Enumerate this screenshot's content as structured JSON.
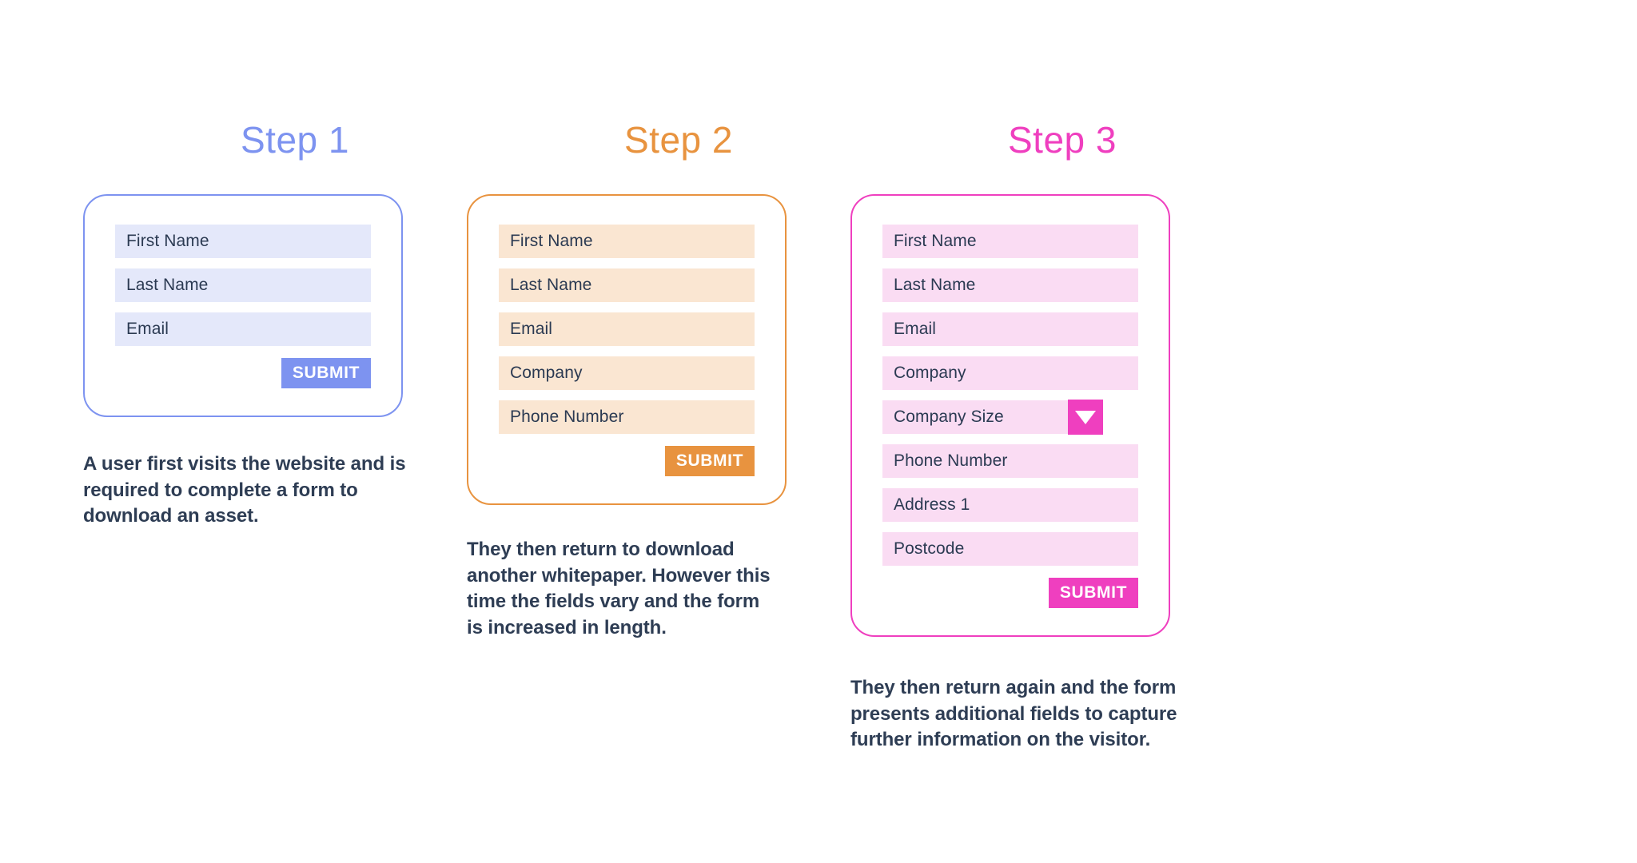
{
  "page": {
    "background": "#ffffff",
    "text_color": "#2e3d54"
  },
  "steps": [
    {
      "title": "Step 1",
      "accent": "#7d93f0",
      "field_fill": "#e4e8fa",
      "border": "#7d93f0",
      "submit_label": "SUBMIT",
      "fields": [
        {
          "label": "First Name",
          "type": "text"
        },
        {
          "label": "Last Name",
          "type": "text"
        },
        {
          "label": "Email",
          "type": "text"
        }
      ],
      "caption": "A user first visits the website and is required to complete a form to download an asset."
    },
    {
      "title": "Step 2",
      "accent": "#e8933f",
      "field_fill": "#fae6d2",
      "border": "#e8933f",
      "submit_label": "SUBMIT",
      "fields": [
        {
          "label": "First Name",
          "type": "text"
        },
        {
          "label": "Last Name",
          "type": "text"
        },
        {
          "label": "Email",
          "type": "text"
        },
        {
          "label": "Company",
          "type": "text"
        },
        {
          "label": "Phone Number",
          "type": "text"
        }
      ],
      "caption": "They then return to download another whitepaper. However this time the fields vary and the form is increased in length."
    },
    {
      "title": "Step 3",
      "accent": "#ef3fbf",
      "field_fill": "#fadcf3",
      "border": "#ef3fbf",
      "submit_label": "SUBMIT",
      "fields": [
        {
          "label": "First Name",
          "type": "text"
        },
        {
          "label": "Last Name",
          "type": "text"
        },
        {
          "label": "Email",
          "type": "text"
        },
        {
          "label": "Company",
          "type": "text"
        },
        {
          "label": "Company Size",
          "type": "dropdown",
          "icon": "chevron-down-icon"
        },
        {
          "label": "Phone Number",
          "type": "text"
        },
        {
          "label": "Address 1",
          "type": "text"
        },
        {
          "label": "Postcode",
          "type": "text"
        }
      ],
      "caption": "They then return again and the form presents additional fields to capture further information on the visitor."
    }
  ]
}
